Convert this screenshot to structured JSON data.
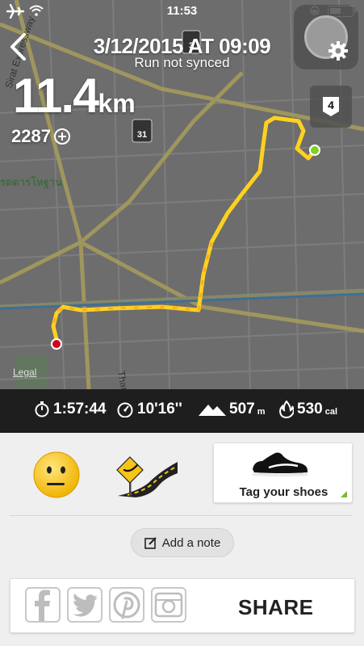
{
  "status_bar": {
    "time": "11:53",
    "battery_level": 0.5
  },
  "header": {
    "date_time": "3/12/2015 AT 09:09",
    "sync_status": "Run not synced"
  },
  "run": {
    "distance_value": "11.4",
    "distance_unit": "km",
    "fuel": "2287"
  },
  "map": {
    "legal_label": "Legal",
    "road_badge_number": "4",
    "shields": [
      "3",
      "31"
    ],
    "road_labels": [
      "Sirat Expressway",
      "Than",
      "รดดารโหฐาน"
    ],
    "colors": {
      "route_yellow": "#ffd11f",
      "route_orange": "#f6a623",
      "start_green": "#7ed321",
      "end_red": "#d0021b"
    }
  },
  "stats": {
    "duration": "1:57:44",
    "pace": "10'16''",
    "elevation": "507",
    "elevation_unit": "m",
    "calories": "530",
    "calories_unit": "cal"
  },
  "panel": {
    "shoes_label": "Tag your shoes",
    "note_label": "Add a note",
    "share_label": "SHARE",
    "mood_icon": "neutral-face-icon",
    "terrain_icon": "road-terrain-icon"
  }
}
